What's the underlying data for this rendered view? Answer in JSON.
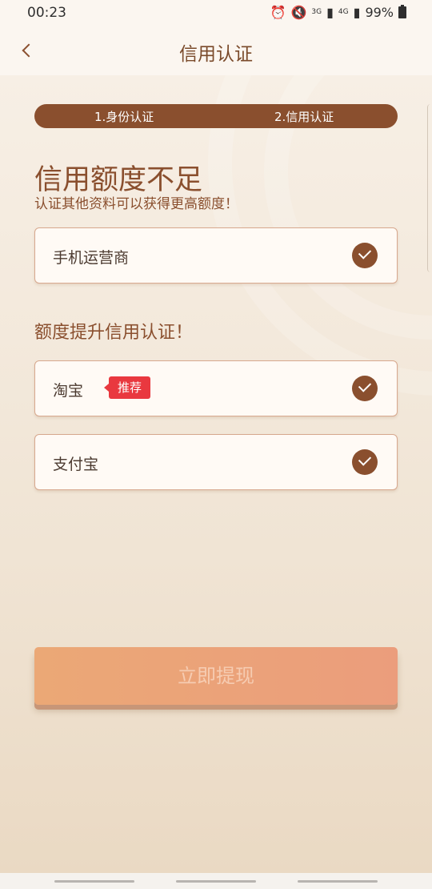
{
  "status_bar": {
    "time": "00:23",
    "network_1": "3G",
    "network_2": "4G",
    "battery": "99%"
  },
  "header": {
    "title": "信用认证"
  },
  "steps": [
    {
      "label": "1.身份认证"
    },
    {
      "label": "2.信用认证"
    }
  ],
  "headline": "信用额度不足",
  "subline": "认证其他资料可以获得更高额度！",
  "basic_items": [
    {
      "label": "手机运营商",
      "checked": true
    }
  ],
  "section_title": "额度提升信用认证！",
  "extra_items": [
    {
      "label": "淘宝",
      "badge": "推荐",
      "checked": true
    },
    {
      "label": "支付宝",
      "checked": true
    }
  ],
  "withdraw_button": "立即提现",
  "colors": {
    "brand_brown": "#8a4f2e",
    "badge_red": "#e9383f",
    "button_orange": "#eba876"
  }
}
